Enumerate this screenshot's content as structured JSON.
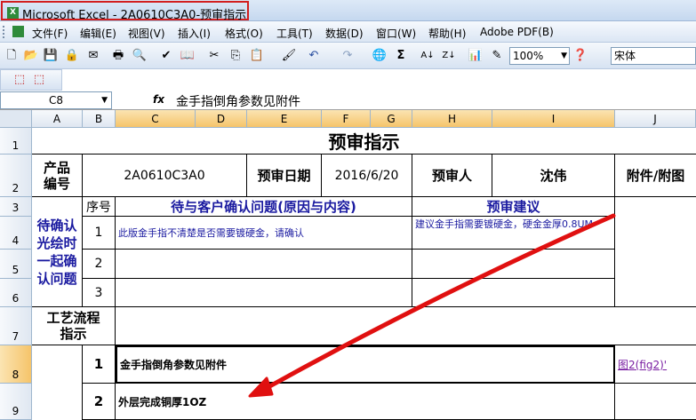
{
  "window": {
    "title": "Microsoft Excel - 2A0610C3A0-预审指示",
    "app_icon": "X"
  },
  "menu": [
    "文件(F)",
    "编辑(E)",
    "视图(V)",
    "插入(I)",
    "格式(O)",
    "工具(T)",
    "数据(D)",
    "窗口(W)",
    "帮助(H)",
    "Adobe PDF(B)"
  ],
  "toolbar": {
    "zoom": "100%",
    "font": "宋体"
  },
  "formula_bar": {
    "name_box": "C8",
    "fx": "fx",
    "content": "金手指倒角参数见附件"
  },
  "columns": [
    "A",
    "B",
    "C",
    "D",
    "E",
    "F",
    "G",
    "H",
    "I",
    "J"
  ],
  "rows": [
    "1",
    "2",
    "3",
    "4",
    "5",
    "6",
    "7",
    "8",
    "9"
  ],
  "sheet": {
    "title": "预审指示",
    "product_label": "产品\n编号",
    "product_code": "2A0610C3A0",
    "review_date_label": "预审日期",
    "review_date": "2016/6/20",
    "reviewer_label": "预审人",
    "reviewer": "沈伟",
    "attachment_label": "附件/附图",
    "confirm_label": "待确认\n光绘时\n一起确\n认问题",
    "seq_label": "序号",
    "issues_header": "待与客户确认问题(原因与内容)",
    "advice_header": "预审建议",
    "issue_1_no": "1",
    "issue_1": "此版金手指不清楚是否需要镀硬金，请确认",
    "advice_1": "建议金手指需要镀硬金，硬金金厚0.8UM",
    "issue_2_no": "2",
    "issue_3_no": "3",
    "process_label": "工艺流程\n指示",
    "step_1_no": "1",
    "step_1": "金手指倒角参数见附件",
    "step_1_link": "图2(fig2)'",
    "step_2_no": "2",
    "step_2": "外层完成铜厚1OZ"
  },
  "colors": {
    "selection": "#f5c46a",
    "title_highlight": "#d21f1f",
    "annotation_arrow": "#e01010",
    "header_text": "#1a1aa0"
  }
}
